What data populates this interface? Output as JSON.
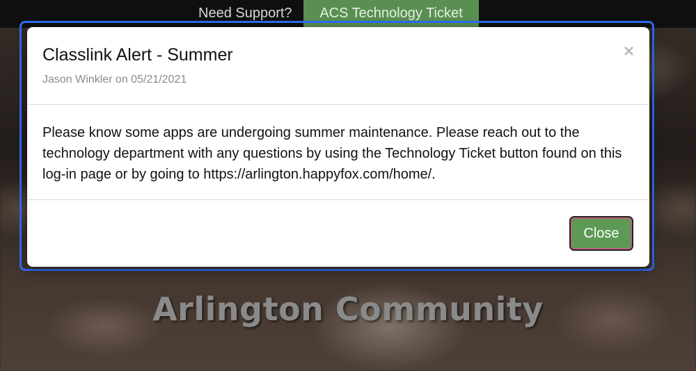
{
  "topbar": {
    "support_label": "Need Support?",
    "ticket_button_label": "ACS Technology Ticket"
  },
  "background": {
    "headline": "Arlington Community"
  },
  "modal": {
    "title": "Classlink Alert - Summer",
    "meta": "Jason Winkler on 05/21/2021",
    "close_x": "×",
    "message": "Please know some apps are undergoing summer maintenance. Please reach out to the technology department with any questions by using the Technology Ticket button found on this log-in page or by going to https://arlington.happyfox.com/home/.",
    "close_button_label": "Close"
  },
  "colors": {
    "accent_green": "#5c9a55",
    "focus_blue": "#2f6df6"
  }
}
